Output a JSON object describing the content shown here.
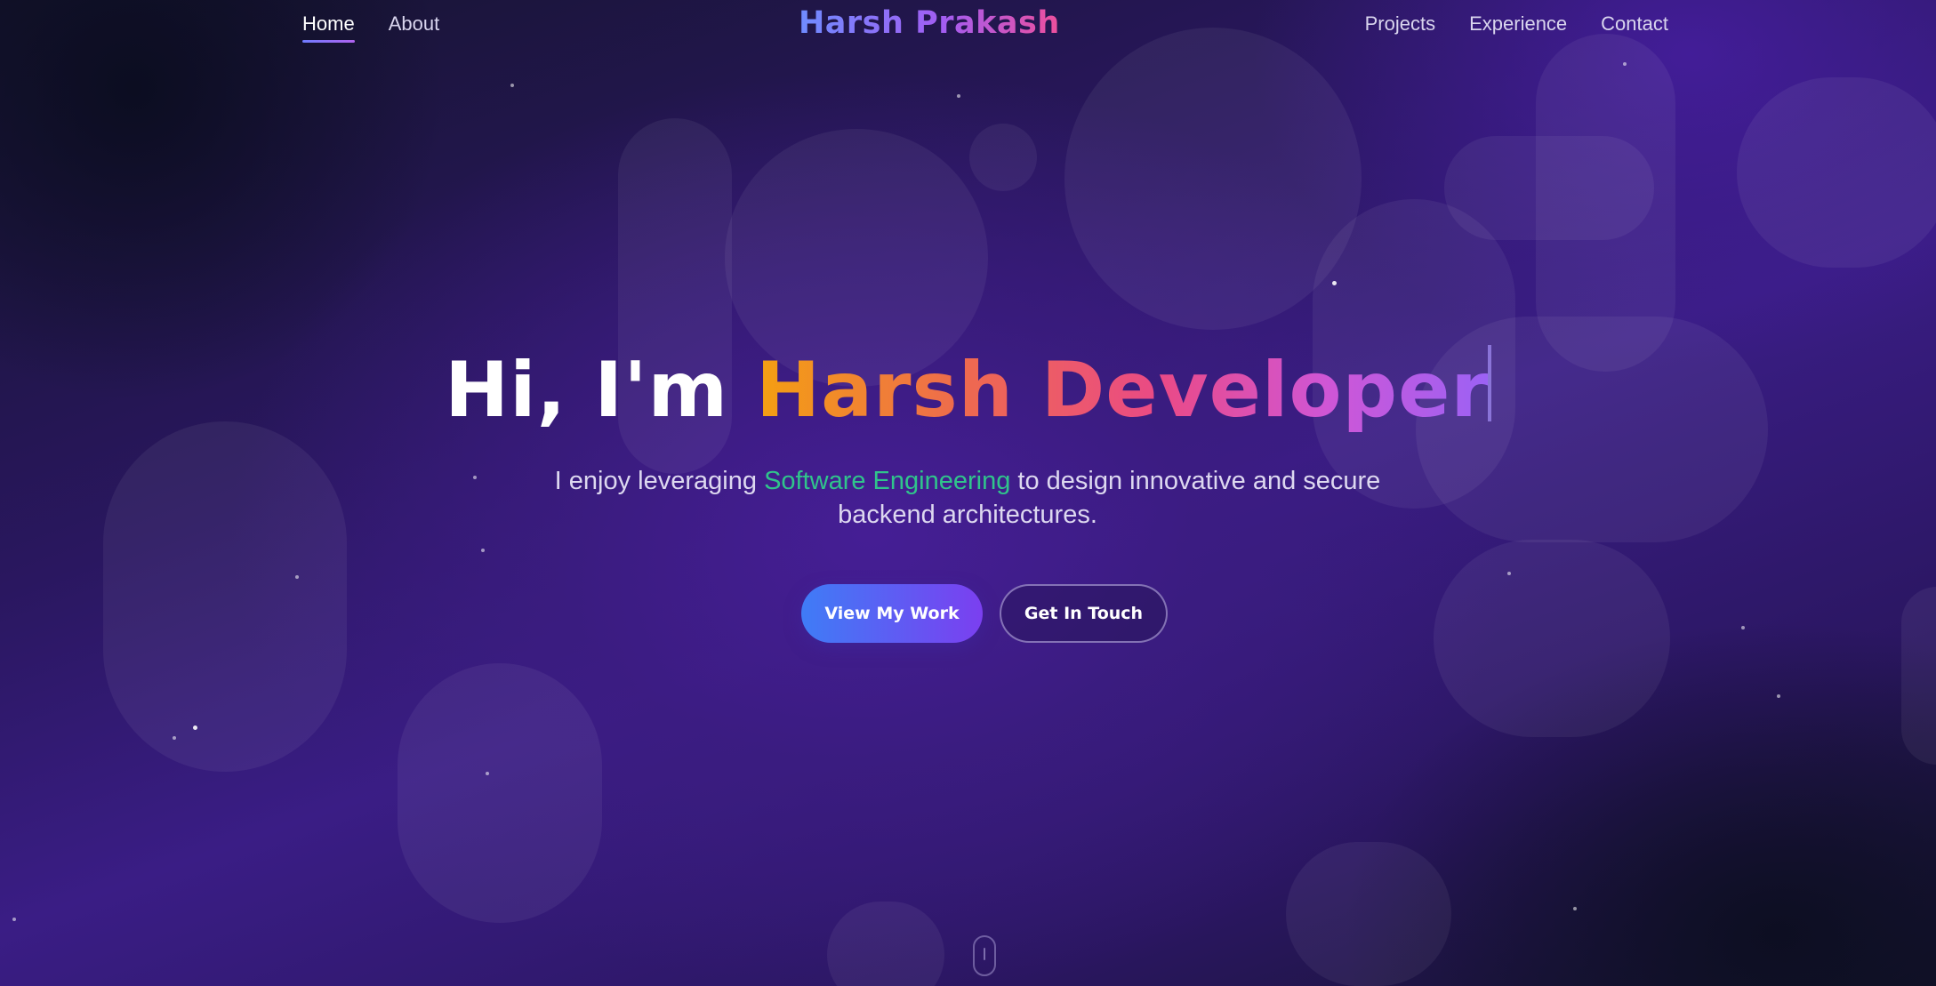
{
  "nav": {
    "left": [
      {
        "label": "Home"
      },
      {
        "label": "About"
      }
    ],
    "logo": "Harsh Prakash",
    "right": [
      {
        "label": "Projects"
      },
      {
        "label": "Experience"
      },
      {
        "label": "Contact"
      }
    ],
    "active_item": "Home"
  },
  "hero": {
    "greeting": "Hi, I'm",
    "typed_text": "Harsh Developer",
    "subtitle_before": "I enjoy leveraging",
    "subtitle_highlight": "Software Engineering",
    "subtitle_after": "to design innovative and secure backend architectures.",
    "primary_button": "View My Work",
    "secondary_button": "Get In Touch"
  },
  "icons": {
    "scroll_indicator": "mouse-scroll-icon"
  },
  "colors": {
    "accent_green": "#30c48b",
    "button_gradient_start": "#3f7cf6",
    "button_gradient_end": "#7b3ff0",
    "title_gradient_start": "#f4a011",
    "title_gradient_end": "#9b62f5"
  }
}
